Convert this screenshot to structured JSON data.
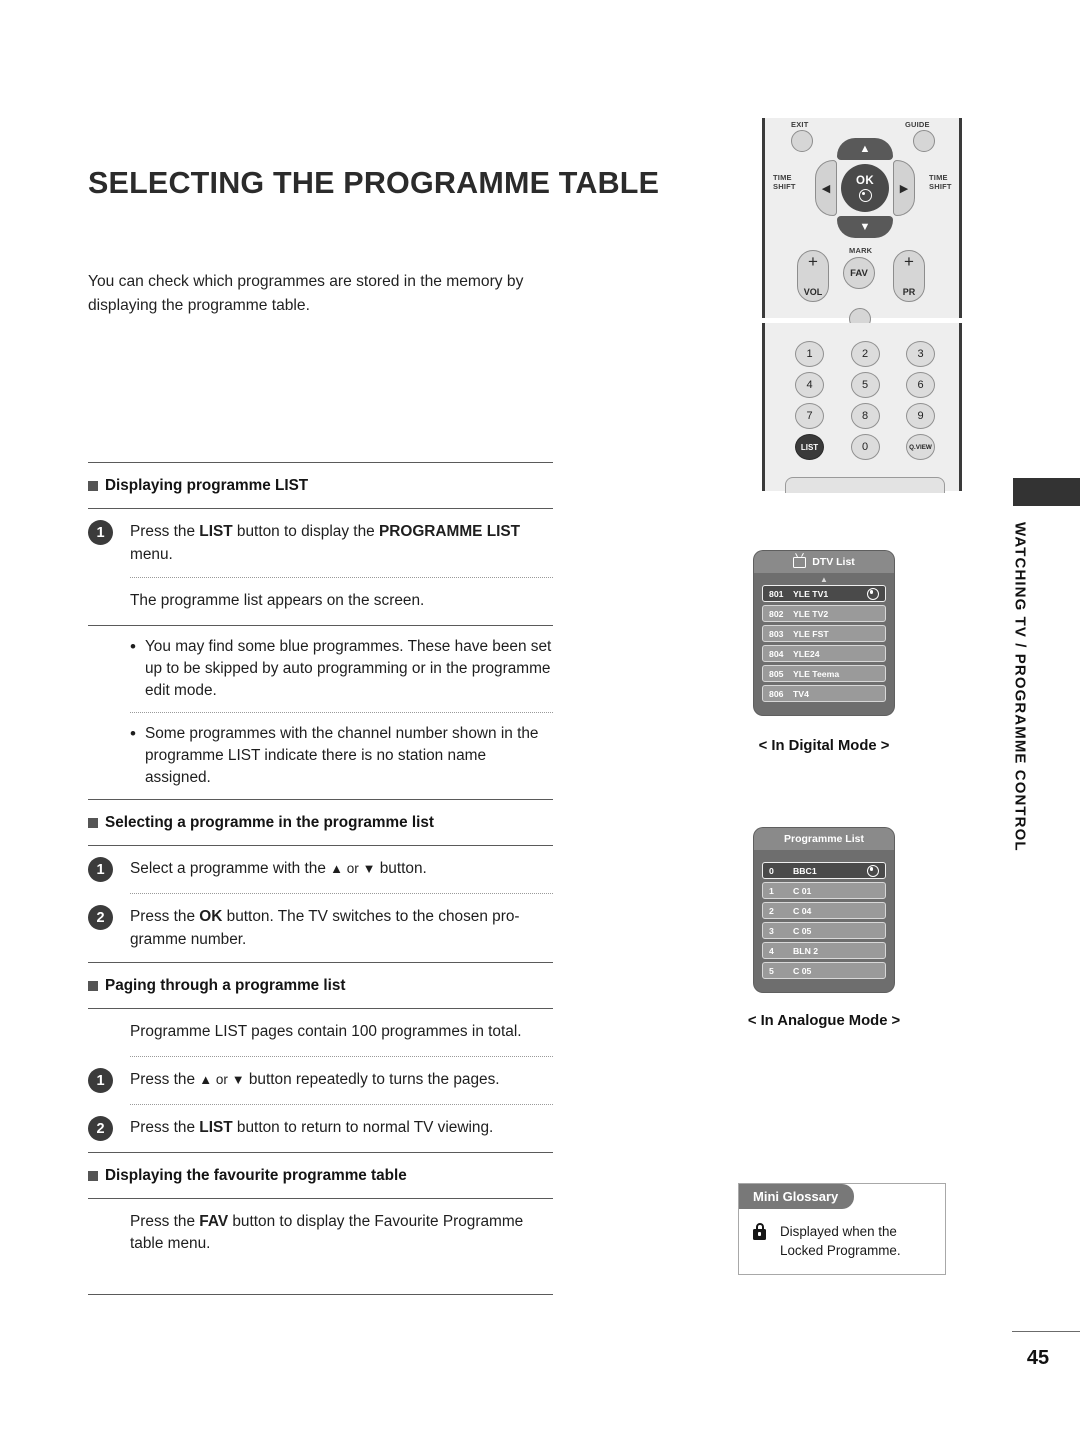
{
  "page": {
    "title": "SELECTING THE PROGRAMME TABLE",
    "intro": "You can check which programmes are stored in the memory by displaying the programme table.",
    "number": "45",
    "sidebar_label": "WATCHING TV / PROGRAMME CONTROL"
  },
  "sections": {
    "displaying_list": {
      "heading": "Displaying programme LIST",
      "step1_pre": "Press the ",
      "step1_b1": "LIST",
      "step1_mid": " button to display the ",
      "step1_b2": "PROGRAMME LIST",
      "step1_post": " menu.",
      "note": "The programme list appears on the screen.",
      "bullet1": "You may find some blue programmes. These have been set up to be skipped by auto programming or in the programme edit mode.",
      "bullet2": "Some programmes with the channel number shown in the programme LIST indicate there is no station name assigned."
    },
    "selecting": {
      "heading": "Selecting a programme in the programme list",
      "step1_pre": "Select a programme with the ",
      "step1_up": "▲",
      "step1_or": " or ",
      "step1_dn": "▼",
      "step1_post": " button.",
      "step2_pre": "Press the ",
      "step2_b": "OK",
      "step2_post": " button. The TV switches to the chosen pro-gramme number."
    },
    "paging": {
      "heading": "Paging through a programme list",
      "note": "Programme LIST pages contain 100 programmes in total.",
      "step1_pre": "Press the ",
      "step1_up": "▲",
      "step1_or": " or ",
      "step1_dn": "▼",
      "step1_post": " button repeatedly to turns the pages.",
      "step2_pre": "Press the ",
      "step2_b": "LIST",
      "step2_post": " button to return to normal TV viewing."
    },
    "favourite": {
      "heading": "Displaying the favourite programme table",
      "note_pre": "Press the ",
      "note_b": "FAV",
      "note_post": " button to display the Favourite Programme table menu."
    }
  },
  "remote": {
    "exit_label": "EXIT",
    "guide_label": "GUIDE",
    "timeshift_left": "TIME\nSHIFT",
    "timeshift_right": "TIME\nSHIFT",
    "ok_label": "OK",
    "up_glyph": "▲",
    "down_glyph": "▼",
    "left_glyph": "◀",
    "right_glyph": "▶",
    "vol_label": "VOL",
    "pr_label": "PR",
    "plus_glyph": "+",
    "mark_label": "MARK",
    "fav_label": "FAV",
    "keys": [
      [
        "1",
        "2",
        "3"
      ],
      [
        "4",
        "5",
        "6"
      ],
      [
        "7",
        "8",
        "9"
      ],
      [
        "LIST",
        "0",
        "Q.VIEW"
      ]
    ]
  },
  "osd": {
    "digital": {
      "title": "DTV List",
      "caption": "< In Digital Mode >",
      "rows": [
        {
          "num": "801",
          "name": "YLE TV1",
          "selected": true,
          "mark": true
        },
        {
          "num": "802",
          "name": "YLE TV2",
          "selected": false,
          "mark": false
        },
        {
          "num": "803",
          "name": "YLE FST",
          "selected": false,
          "mark": false
        },
        {
          "num": "804",
          "name": "YLE24",
          "selected": false,
          "mark": false
        },
        {
          "num": "805",
          "name": "YLE Teema",
          "selected": false,
          "mark": false
        },
        {
          "num": "806",
          "name": "TV4",
          "selected": false,
          "mark": false
        }
      ]
    },
    "analogue": {
      "title": "Programme List",
      "caption": "< In Analogue Mode >",
      "rows": [
        {
          "num": "0",
          "name": "BBC1",
          "selected": true,
          "mark": true
        },
        {
          "num": "1",
          "name": "C 01",
          "selected": false,
          "mark": false
        },
        {
          "num": "2",
          "name": "C 04",
          "selected": false,
          "mark": false
        },
        {
          "num": "3",
          "name": "C 05",
          "selected": false,
          "mark": false
        },
        {
          "num": "4",
          "name": "BLN 2",
          "selected": false,
          "mark": false
        },
        {
          "num": "5",
          "name": "C 05",
          "selected": false,
          "mark": false
        }
      ]
    }
  },
  "glossary": {
    "title": "Mini Glossary",
    "text": "Displayed when the Locked Programme."
  },
  "colors": {
    "accent_dark": "#3a3a3a",
    "osd_panel": "#6e6e6e",
    "osd_header": "#8a8a8a",
    "osd_selected": "#4a4a4a"
  }
}
